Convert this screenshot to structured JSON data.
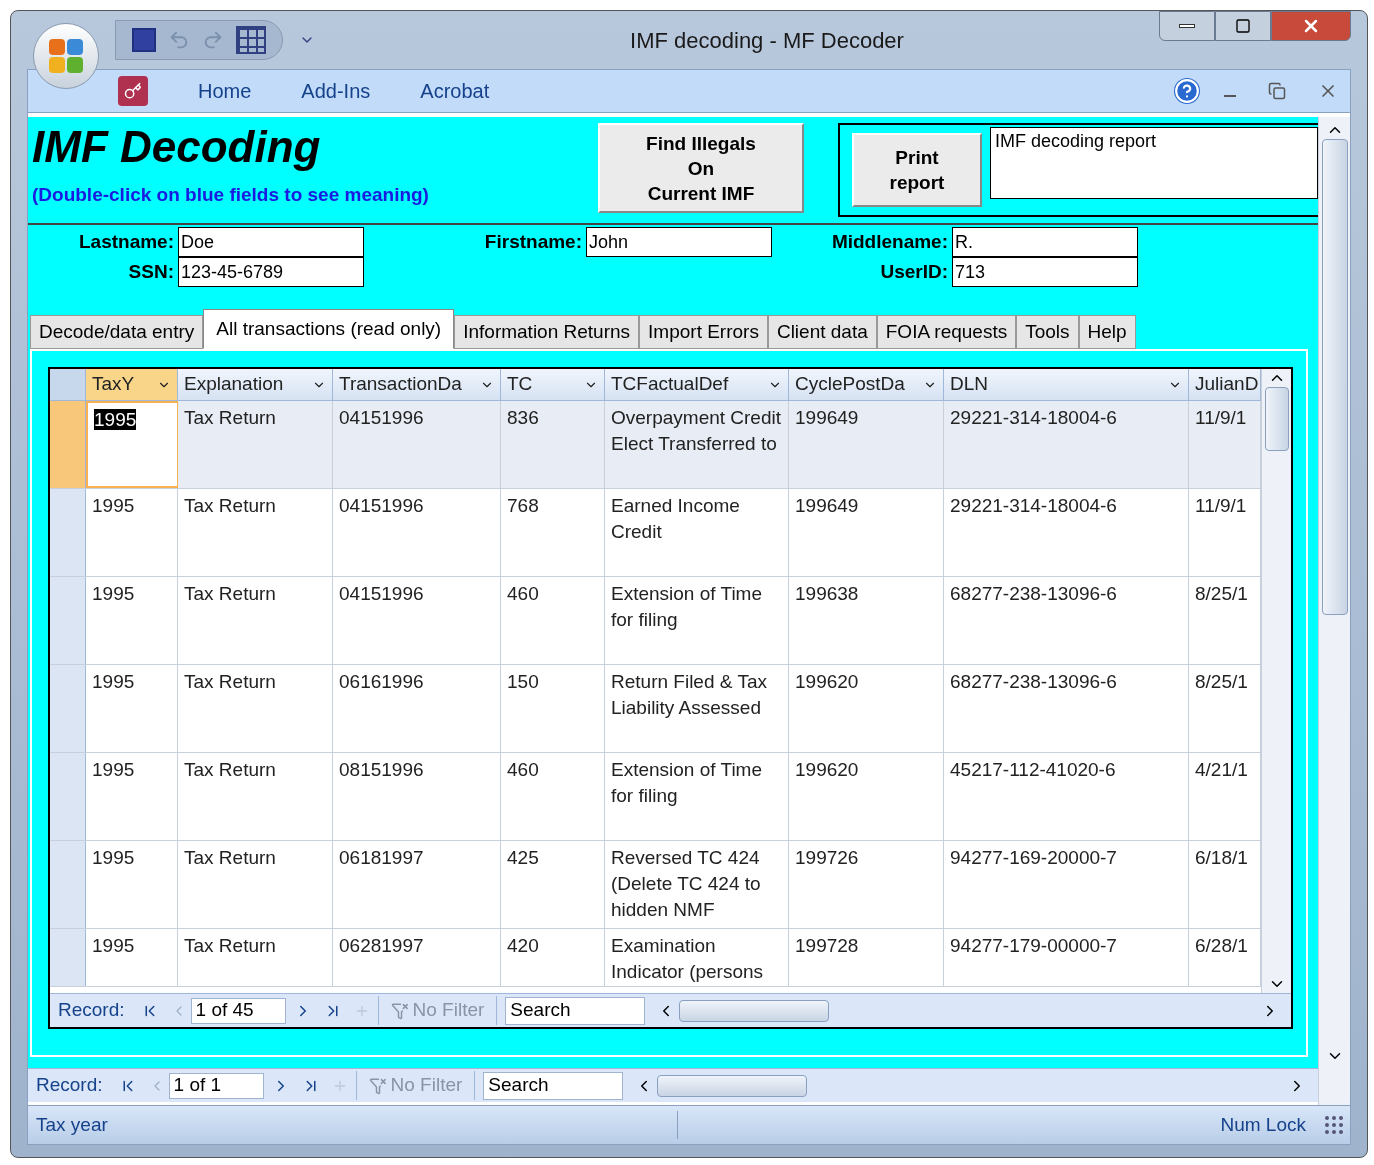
{
  "window": {
    "title": "IMF decoding  -  MF Decoder"
  },
  "ribbon_tabs": [
    "Home",
    "Add-Ins",
    "Acrobat"
  ],
  "form": {
    "title": "IMF Decoding",
    "subtitle": "(Double-click on blue fields to see meaning)",
    "find_button": "Find Illegals\nOn\nCurrent IMF",
    "print_button": "Print\nreport",
    "report_name": "IMF decoding report",
    "fields": [
      {
        "label": "Lastname:",
        "value": "Doe"
      },
      {
        "label": "Firstname:",
        "value": "John"
      },
      {
        "label": "Middlename:",
        "value": "R."
      },
      {
        "label": "SSN:",
        "value": "123-45-6789"
      },
      {
        "label": "UserID:",
        "value": "713"
      }
    ]
  },
  "tabs": [
    {
      "label": "Decode/data entry",
      "selected": false
    },
    {
      "label": "All transactions (read only)",
      "selected": true
    },
    {
      "label": "Information Returns",
      "selected": false
    },
    {
      "label": "Import Errors",
      "selected": false
    },
    {
      "label": "Client data",
      "selected": false
    },
    {
      "label": "FOIA requests",
      "selected": false
    },
    {
      "label": "Tools",
      "selected": false
    },
    {
      "label": "Help",
      "selected": false
    }
  ],
  "table": {
    "columns": [
      "TaxY",
      "Explanation",
      "TransactionDa",
      "TC",
      "TCFactualDef",
      "CyclePostDa",
      "DLN",
      "JulianD"
    ],
    "rows": [
      {
        "selected": true,
        "cells": [
          "1995",
          "Tax Return",
          "04151996",
          "836",
          "Overpayment Credit Elect Transferred to",
          "199649",
          "29221-314-18004-6",
          "11/9/1"
        ]
      },
      {
        "selected": false,
        "cells": [
          "1995",
          "Tax Return",
          "04151996",
          "768",
          "Earned Income Credit",
          "199649",
          "29221-314-18004-6",
          "11/9/1"
        ]
      },
      {
        "selected": false,
        "cells": [
          "1995",
          "Tax Return",
          "04151996",
          "460",
          "Extension of Time for filing",
          "199638",
          "68277-238-13096-6",
          "8/25/1"
        ]
      },
      {
        "selected": false,
        "cells": [
          "1995",
          "Tax Return",
          "06161996",
          "150",
          "Return Filed & Tax Liability Assessed",
          "199620",
          "68277-238-13096-6",
          "8/25/1"
        ]
      },
      {
        "selected": false,
        "cells": [
          "1995",
          "Tax Return",
          "08151996",
          "460",
          "Extension of Time for filing",
          "199620",
          "45217-112-41020-6",
          "4/21/1"
        ]
      },
      {
        "selected": false,
        "cells": [
          "1995",
          "Tax Return",
          "06181997",
          "425",
          "Reversed TC 424 (Delete TC 424 to hidden NMF",
          "199726",
          "94277-169-20000-7",
          "6/18/1"
        ]
      },
      {
        "selected": false,
        "cells": [
          "1995",
          "Tax Return",
          "06281997",
          "420",
          "Examination Indicator (persons",
          "199728",
          "94277-179-00000-7",
          "6/28/1"
        ]
      }
    ],
    "navigator": {
      "label": "Record:",
      "position": "1 of 45",
      "filter": "No Filter",
      "search": "Search"
    }
  },
  "form_navigator": {
    "label": "Record:",
    "position": "1 of 1",
    "filter": "No Filter",
    "search": "Search"
  },
  "status_bar": {
    "left": "Tax year",
    "right": "Num Lock"
  }
}
